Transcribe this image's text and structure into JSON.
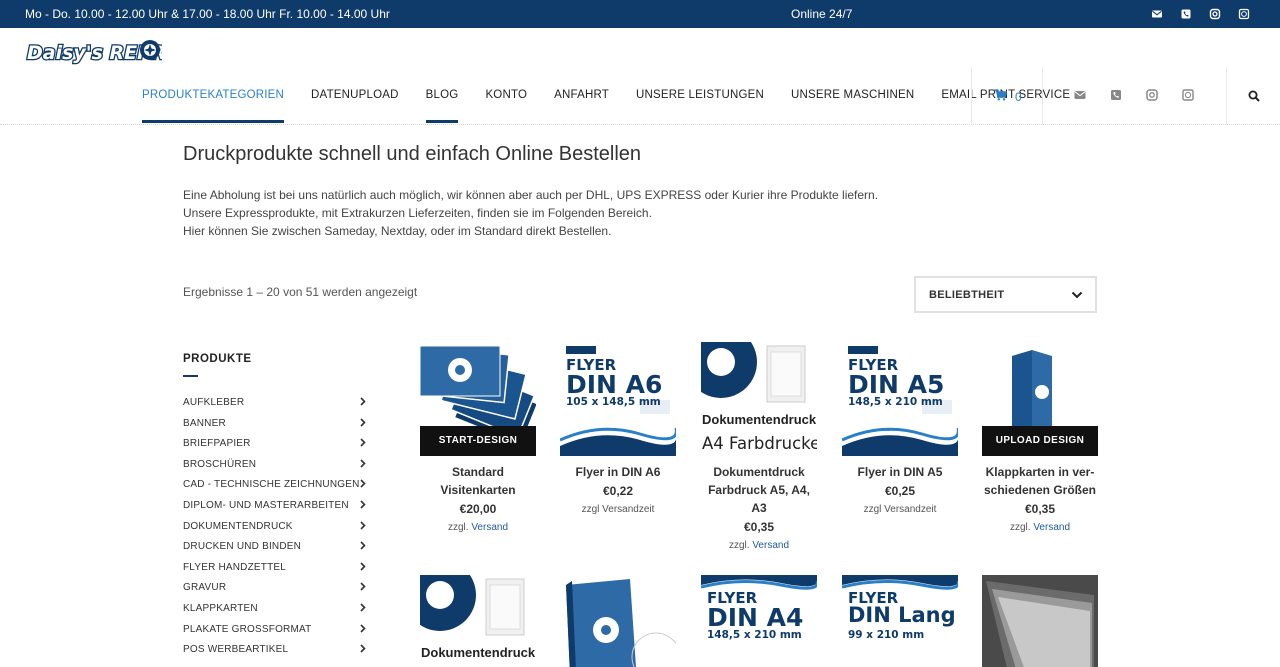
{
  "topbar": {
    "hours": "Mo - Do. 10.00 - 12.00 Uhr & 17.00 - 18.00 Uhr Fr. 10.00 - 14.00 Uhr",
    "online": "Online 24/7",
    "icons": [
      "mail-icon",
      "phone-icon",
      "instagram-icon",
      "whatsapp-icon"
    ]
  },
  "header": {
    "logo_text": "Daisy's REPRO",
    "nav": [
      {
        "label": "PRODUKTEKATEGORIEN"
      },
      {
        "label": "DATENUPLOAD"
      },
      {
        "label": "BLOG"
      },
      {
        "label": "KONTO"
      },
      {
        "label": "ANFAHRT"
      },
      {
        "label": "UNSERE LEISTUNGEN"
      },
      {
        "label": "UNSERE MASCHINEN"
      },
      {
        "label": "EMAIL PRINT SERVICE"
      }
    ],
    "cart_count": "0"
  },
  "main": {
    "title": "Druckprodukte schnell und einfach Online Bestellen",
    "intro": [
      "Eine Abholung ist bei uns natürlich auch möglich, wir können aber auch per DHL, UPS EXPRESS oder Kurier ihre Produkte liefern.",
      "Unsere Expressprodukte, mit Extrakurzen Lieferzeiten, finden sie im Folgenden Bereich.",
      "Hier können Sie zwischen Sameday, Nextday, oder im Standard direkt Bestellen."
    ],
    "results": "Ergebnisse 1 – 20 von 51 werden angezeigt",
    "sort_label": "BELIEBTHEIT"
  },
  "sidebar": {
    "title": "PRODUKTE",
    "categories": [
      "AUFKLEBER",
      "BANNER",
      "BRIEFPAPIER",
      "BROSCHÜREN",
      "CAD - TECHNISCHE ZEICHNUNGEN",
      "DIPLOM- UND MASTERARBEITEN",
      "DOKUMENTENDRUCK",
      "DRUCKEN UND BINDEN",
      "FLYER HANDZETTEL",
      "GRAVUR",
      "KLAPPKARTEN",
      "PLAKATE GROSSFORMAT",
      "POS WERBEARTIKEL"
    ]
  },
  "products": [
    {
      "name1": "Standard",
      "name2": "Visitenkarten",
      "price": "€20,00",
      "note": "zzgl.",
      "note_link": "Versand",
      "overlay": "START-DESIGN"
    },
    {
      "name1": "Flyer in DIN A6",
      "name2": "",
      "price": "€0,22",
      "note": "zzgl Versandzeit",
      "note_link": "",
      "flyer_line1": "FLYER",
      "flyer_line2": "DIN A6",
      "flyer_line3": "105 x 148,5 mm"
    },
    {
      "name1": "Dokumentdruck",
      "name2": "Farbdruck A5, A4, A3",
      "price": "€0,35",
      "note": "zzgl.",
      "note_link": "Versand",
      "img_line1": "Dokumentendruck",
      "img_line2": "A4 Farbdrucke"
    },
    {
      "name1": "Flyer in DIN A5",
      "name2": "",
      "price": "€0,25",
      "note": "zzgl Versandzeit",
      "note_link": "",
      "flyer_line1": "FLYER",
      "flyer_line2": "DIN A5",
      "flyer_line3": "148,5 x 210 mm"
    },
    {
      "name1": "Klappkarten in ver-",
      "name2": "schiedenen Größen",
      "price": "€0,35",
      "note": "zzgl.",
      "note_link": "Versand",
      "overlay": "UPLOAD DESIGN"
    },
    {
      "img_line1": "Dokumentendruck"
    },
    {},
    {
      "flyer_line1": "FLYER",
      "flyer_line2": "DIN A4",
      "flyer_line3": "148,5 x 210 mm"
    },
    {
      "flyer_line1": "FLYER",
      "flyer_line2": "DIN Lang",
      "flyer_line3": "99 x 210 mm"
    },
    {}
  ],
  "colors": {
    "navy": "#0f3b6b",
    "accent": "#2a80c8",
    "link": "#1e5a99"
  }
}
